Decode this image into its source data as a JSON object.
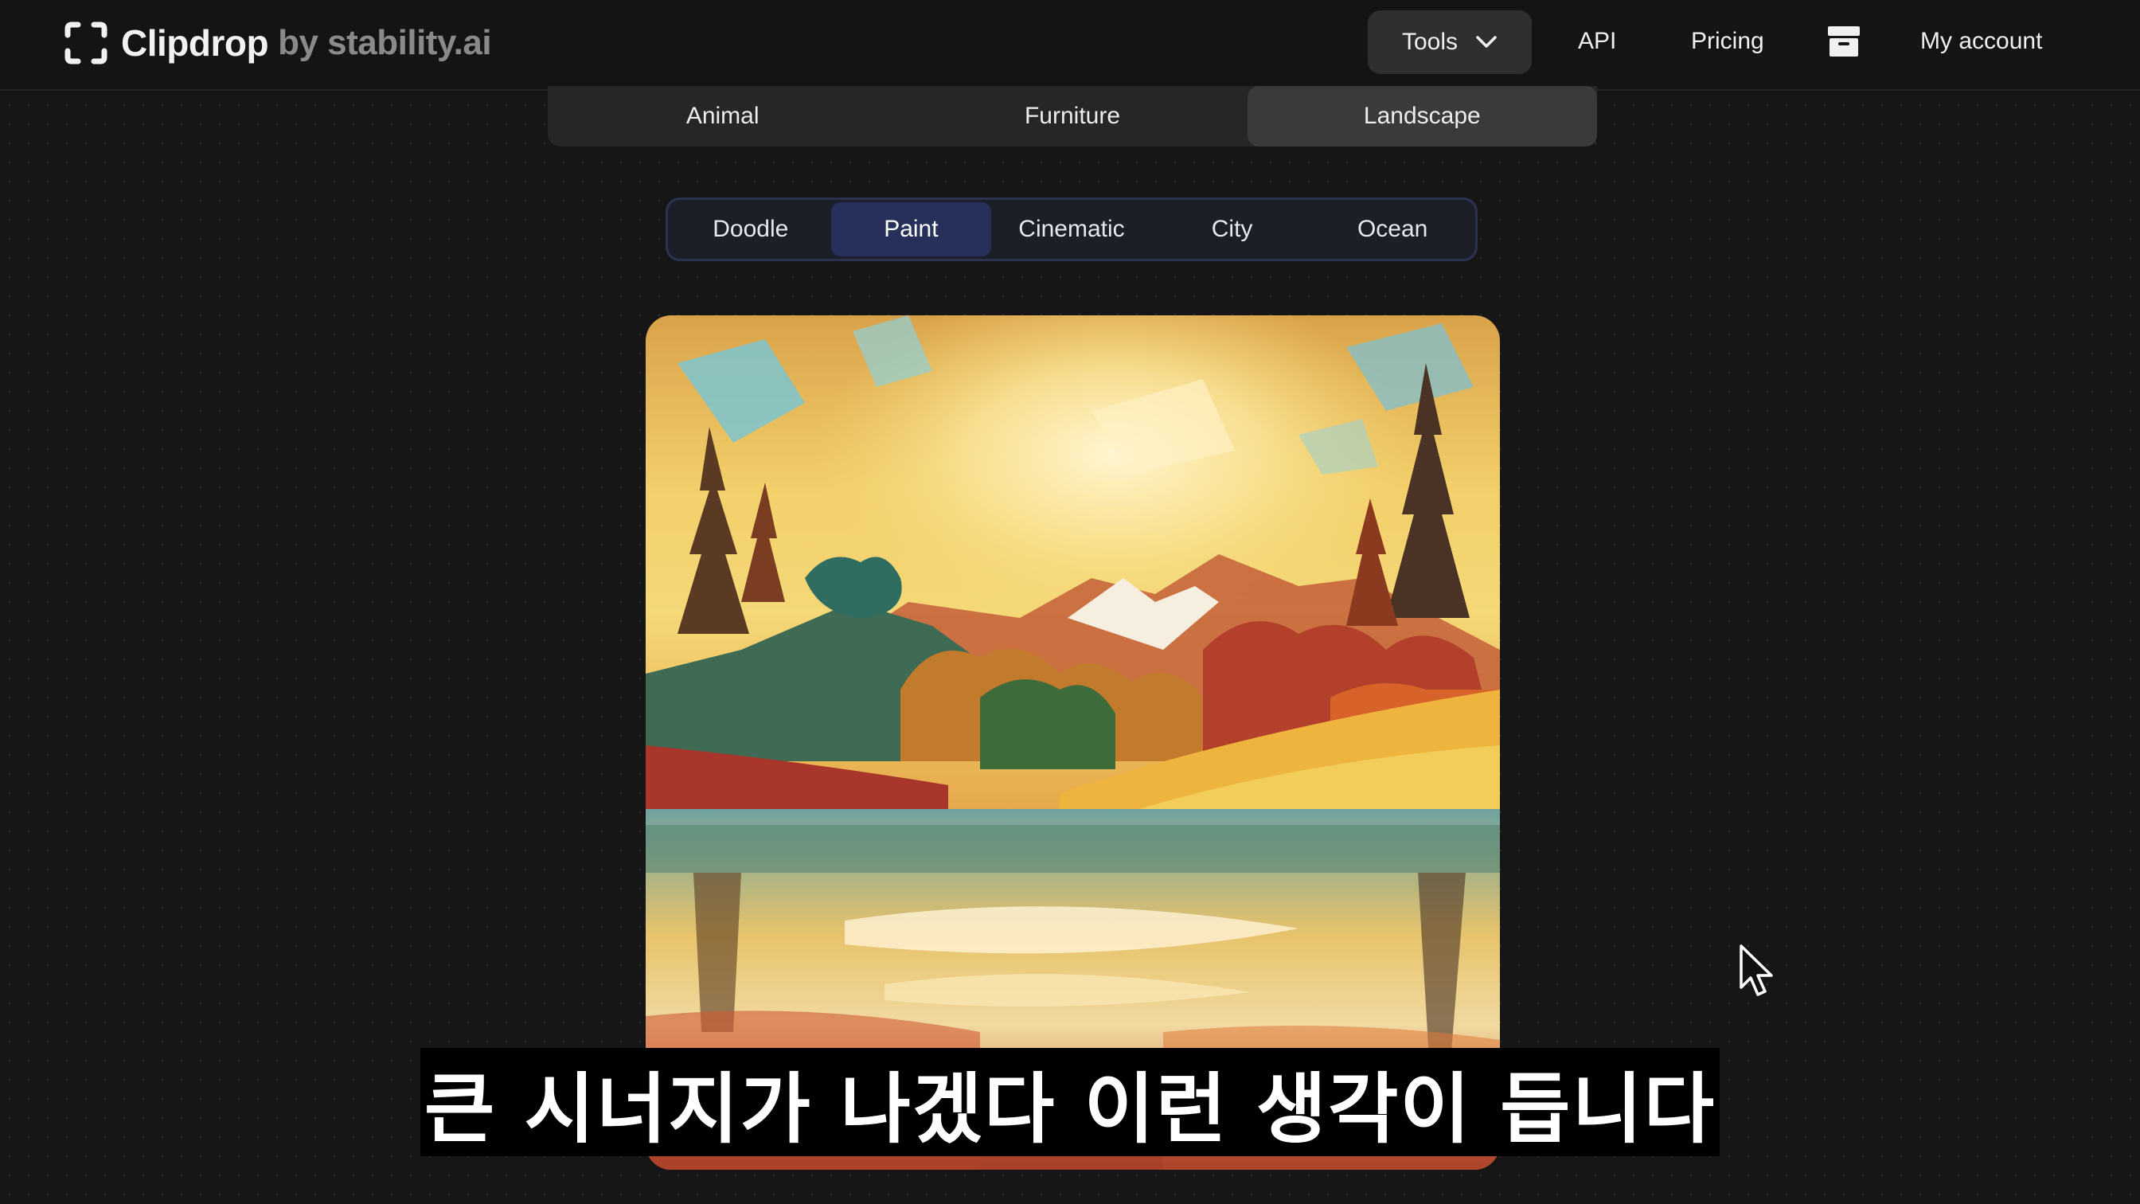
{
  "header": {
    "brand_name": "Clipdrop",
    "brand_suffix": "by stability.ai",
    "nav": {
      "tools_label": "Tools",
      "api_label": "API",
      "pricing_label": "Pricing",
      "account_label": "My account"
    },
    "icons": [
      "clipdrop-logo-icon",
      "chevron-down-icon",
      "archive-icon"
    ]
  },
  "categories": {
    "items": [
      "Animal",
      "Furniture",
      "Landscape"
    ],
    "active": "Landscape"
  },
  "styles": {
    "items": [
      "Doodle",
      "Paint",
      "Cinematic",
      "City",
      "Ocean"
    ],
    "active": "Paint"
  },
  "artwork": {
    "subject": "painted landscape"
  },
  "subtitle": {
    "text": "큰 시너지가 나겠다 이런 생각이 듭니다"
  },
  "colors": {
    "background": "#161616",
    "active_style_tab": "#26305a",
    "active_category_tab": "#3a3a3a"
  }
}
